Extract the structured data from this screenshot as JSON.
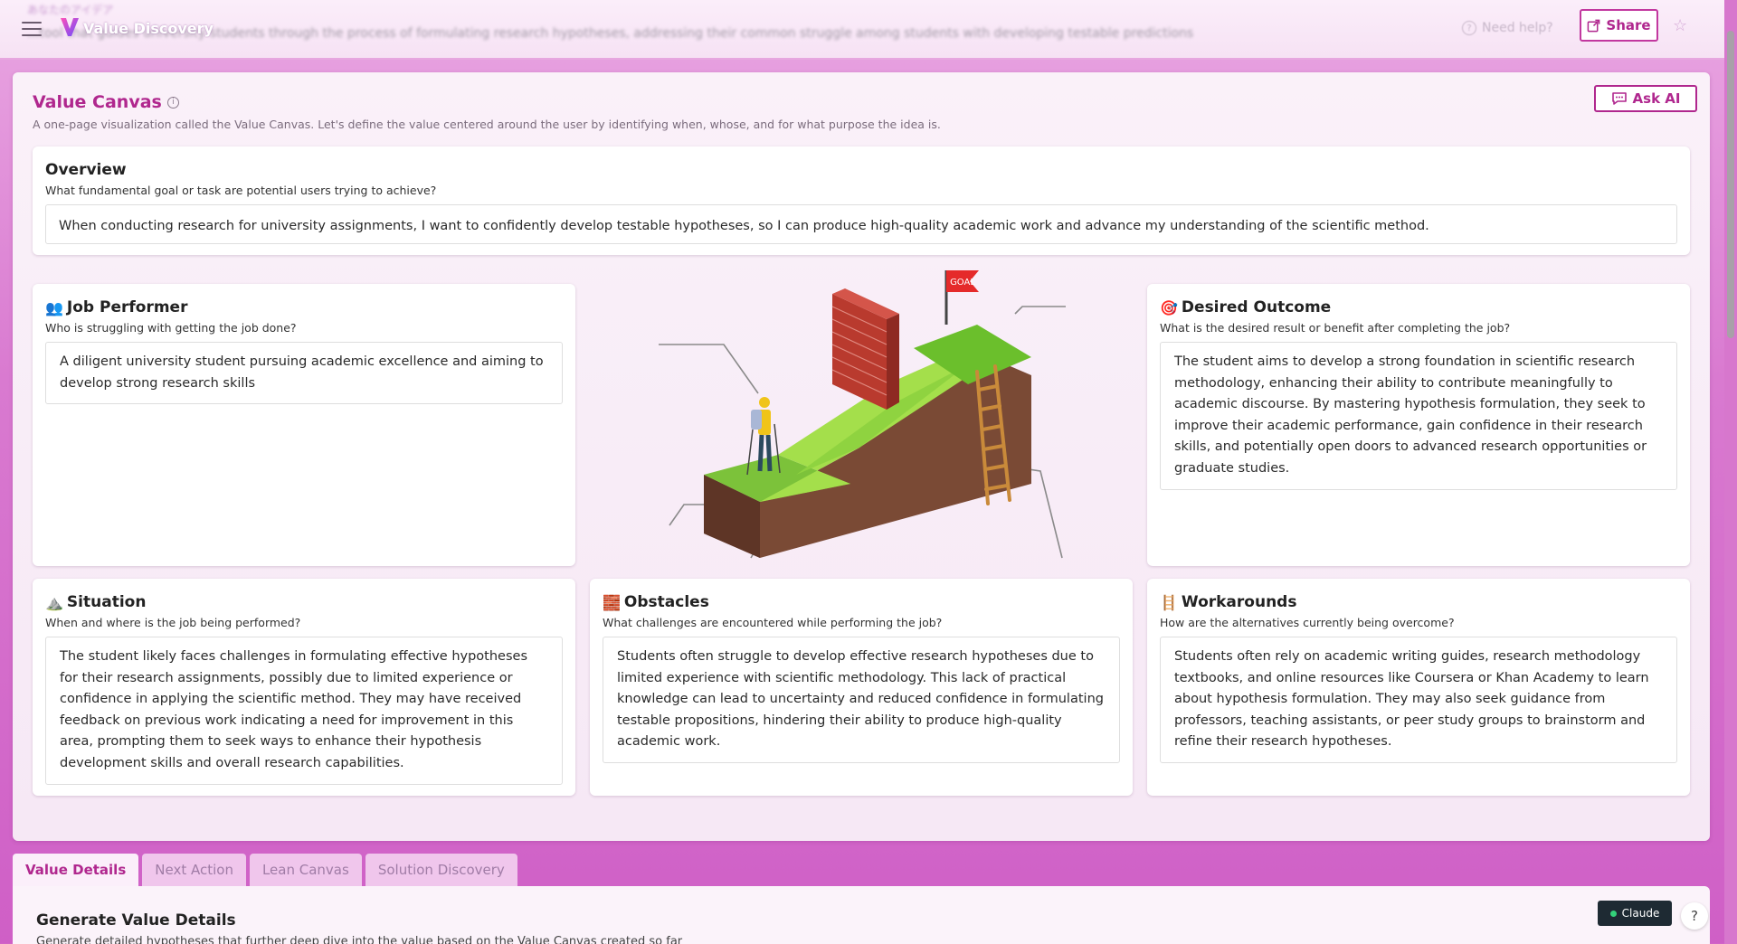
{
  "header": {
    "blurred_japanese_title": "あなたのアイデア",
    "blurred_description": "...tool that guides university students through the process of formulating research hypotheses, addressing their common struggle among students with developing testable predictions",
    "app_title": "Value Discovery",
    "need_help": "Need help?",
    "share_label": "Share"
  },
  "canvas": {
    "title": "Value Canvas",
    "description": "A one-page visualization called the Value Canvas. Let's define the value centered around the user by identifying when, whose, and for what purpose the idea is.",
    "ask_ai_label": "Ask AI"
  },
  "overview": {
    "title": "Overview",
    "question": "What fundamental goal or task are potential users trying to achieve?",
    "answer": "When conducting research for university assignments, I want to confidently develop testable hypotheses, so I can produce high-quality academic work and advance my understanding of the scientific method."
  },
  "job_performer": {
    "emoji": "👥",
    "title": "Job Performer",
    "question": "Who is struggling with getting the job done?",
    "answer": "A diligent university student pursuing academic excellence and aiming to develop strong research skills"
  },
  "illustration": {
    "goal_flag": "GOAL"
  },
  "desired_outcome": {
    "emoji": "🎯",
    "title": "Desired Outcome",
    "question": "What is the desired result or benefit after completing the job?",
    "answer": "The student aims to develop a strong foundation in scientific research methodology, enhancing their ability to contribute meaningfully to academic discourse. By mastering hypothesis formulation, they seek to improve their academic performance, gain confidence in their research skills, and potentially open doors to advanced research opportunities or graduate studies."
  },
  "situation": {
    "emoji": "⛰️",
    "title": "Situation",
    "question": "When and where is the job being performed?",
    "answer": "The student likely faces challenges in formulating effective hypotheses for their research assignments, possibly due to limited experience or confidence in applying the scientific method. They may have received feedback on previous work indicating a need for improvement in this area, prompting them to seek ways to enhance their hypothesis development skills and overall research capabilities."
  },
  "obstacles": {
    "emoji": "🧱",
    "title": "Obstacles",
    "question": "What challenges are encountered while performing the job?",
    "answer": "Students often struggle to develop effective research hypotheses due to limited experience with scientific methodology. This lack of practical knowledge can lead to uncertainty and reduced confidence in formulating testable propositions, hindering their ability to produce high-quality academic work."
  },
  "workarounds": {
    "emoji": "🪜",
    "title": "Workarounds",
    "question": "How are the alternatives currently being overcome?",
    "answer": "Students often rely on academic writing guides, research methodology textbooks, and online resources like Coursera or Khan Academy to learn about hypothesis formulation. They may also seek guidance from professors, teaching assistants, or peer study groups to brainstorm and refine their research hypotheses."
  },
  "tabs": [
    {
      "label": "Value Details",
      "active": true
    },
    {
      "label": "Next Action",
      "active": false
    },
    {
      "label": "Lean Canvas",
      "active": false
    },
    {
      "label": "Solution Discovery",
      "active": false
    }
  ],
  "details": {
    "title": "Generate Value Details",
    "subtitle": "Generate detailed hypotheses that further deep dive into the value based on the Value Canvas created so far",
    "model_badge": "Claude",
    "help": "?"
  },
  "colors": {
    "accent": "#b0278e",
    "page_gradient_top": "#e9a6e2",
    "page_gradient_bottom": "#cf5fc6"
  }
}
